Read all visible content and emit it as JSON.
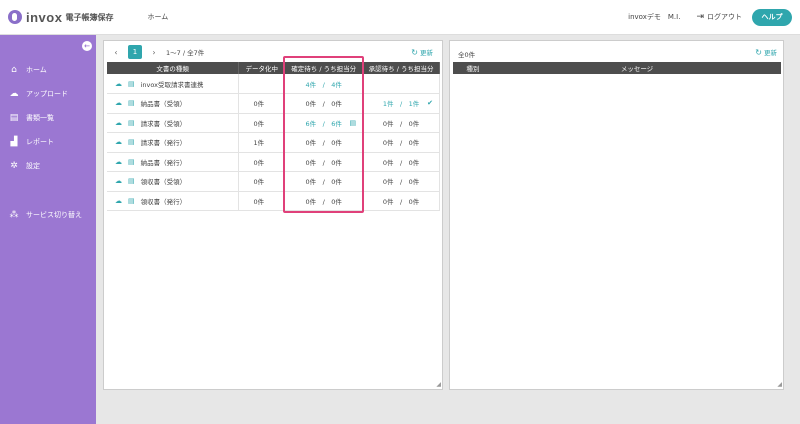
{
  "header": {
    "logo_text": "invox",
    "logo_sub": "電子帳簿保存",
    "nav_home": "ホーム",
    "user": "invoxデモ　M.I.",
    "logout": "ログアウト",
    "help": "ヘルプ"
  },
  "sidebar": {
    "items": [
      {
        "icon": "home-icon",
        "label": "ホーム"
      },
      {
        "icon": "upload-icon",
        "label": "アップロード"
      },
      {
        "icon": "document-icon",
        "label": "書類一覧"
      },
      {
        "icon": "chart-icon",
        "label": "レポート"
      },
      {
        "icon": "gear-icon",
        "label": "設定"
      },
      {
        "icon": "switch-icon",
        "label": "サービス切り替え"
      }
    ]
  },
  "left_panel": {
    "pager": {
      "prev": "‹",
      "page": "1",
      "next": "›",
      "range": "1〜7 / 全7件"
    },
    "refresh": "更新",
    "columns": [
      "文書の種類",
      "データ化中",
      "確定待ち / うち担当分",
      "承認待ち / うち担当分"
    ],
    "rows": [
      {
        "doc": "invox受取請求書連携",
        "data": "",
        "kakutei": "4件　/　4件",
        "shonin": "",
        "kakutei_teal": true,
        "shonin_teal": false,
        "data_teal": false,
        "kakutei_icon": false,
        "shonin_icon": false
      },
      {
        "doc": "納品書（受領）",
        "data": "0件",
        "kakutei": "0件　/　0件",
        "shonin": "1件　/　1件",
        "kakutei_teal": false,
        "shonin_teal": true,
        "data_teal": false,
        "kakutei_icon": false,
        "shonin_icon": true
      },
      {
        "doc": "請求書（受領）",
        "data": "0件",
        "kakutei": "6件　/　6件",
        "shonin": "0件　/　0件",
        "kakutei_teal": true,
        "shonin_teal": false,
        "data_teal": false,
        "kakutei_icon": true,
        "shonin_icon": false
      },
      {
        "doc": "請求書（発行）",
        "data": "1件",
        "kakutei": "0件　/　0件",
        "shonin": "0件　/　0件",
        "kakutei_teal": false,
        "shonin_teal": false,
        "data_teal": true,
        "kakutei_icon": false,
        "shonin_icon": false
      },
      {
        "doc": "納品書（発行）",
        "data": "0件",
        "kakutei": "0件　/　0件",
        "shonin": "0件　/　0件",
        "kakutei_teal": false,
        "shonin_teal": false,
        "data_teal": false,
        "kakutei_icon": false,
        "shonin_icon": false
      },
      {
        "doc": "領収書（受領）",
        "data": "0件",
        "kakutei": "0件　/　0件",
        "shonin": "0件　/　0件",
        "kakutei_teal": false,
        "shonin_teal": false,
        "data_teal": false,
        "kakutei_icon": false,
        "shonin_icon": false
      },
      {
        "doc": "領収書（発行）",
        "data": "0件",
        "kakutei": "0件　/　0件",
        "shonin": "0件　/　0件",
        "kakutei_teal": false,
        "shonin_teal": false,
        "data_teal": false,
        "kakutei_icon": false,
        "shonin_icon": false
      }
    ]
  },
  "right_panel": {
    "count": "全0件",
    "refresh": "更新",
    "columns": [
      "種別",
      "メッセージ"
    ]
  },
  "colors": {
    "accent": "#2fa6ad",
    "sidebar": "#9b77d2",
    "highlight": "#e0407a"
  }
}
